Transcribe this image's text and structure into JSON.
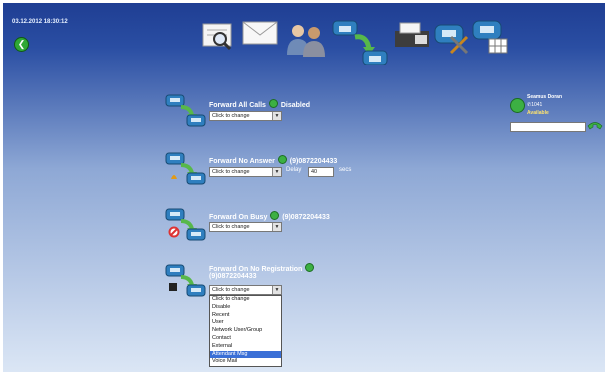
{
  "header": {
    "datetime": "03.12.2012 18:30:12",
    "back_icon": "back-arrow-icon"
  },
  "toolbar": {
    "icons": [
      "phonebook-search-icon",
      "message-envelope-icon",
      "contacts-people-icon",
      "call-forward-icon",
      "fax-machine-icon",
      "phone-settings-icon",
      "phone-grid-icon"
    ]
  },
  "forward_rows": [
    {
      "title": "Forward All Calls",
      "value": "Disabled",
      "select": "Click to change"
    },
    {
      "title": "Forward No Answer",
      "value": "(9)0872204433",
      "select": "Click to change",
      "delay_label": "Delay",
      "delay_value": "40",
      "delay_unit": "secs"
    },
    {
      "title": "Forward On Busy",
      "value": "(9)0872204433",
      "select": "Click to change"
    },
    {
      "title": "Forward On No Registration",
      "value": "(9)0872204433",
      "select": "Click to change"
    }
  ],
  "dropdown_options": [
    "Click to change",
    "Disable",
    "Recent",
    "User",
    "Network User/Group",
    "Contact",
    "External",
    "Attendant Msg",
    "Voice Mail"
  ],
  "dropdown_selected_index": 7,
  "user": {
    "name": "Seamus Doran",
    "extension": "1041",
    "status": "Available",
    "status_color": "#3cb043"
  },
  "colors": {
    "background_top": "#1f3e93",
    "background_bottom": "#dbe6f5",
    "highlight": "#3a6fd6"
  }
}
